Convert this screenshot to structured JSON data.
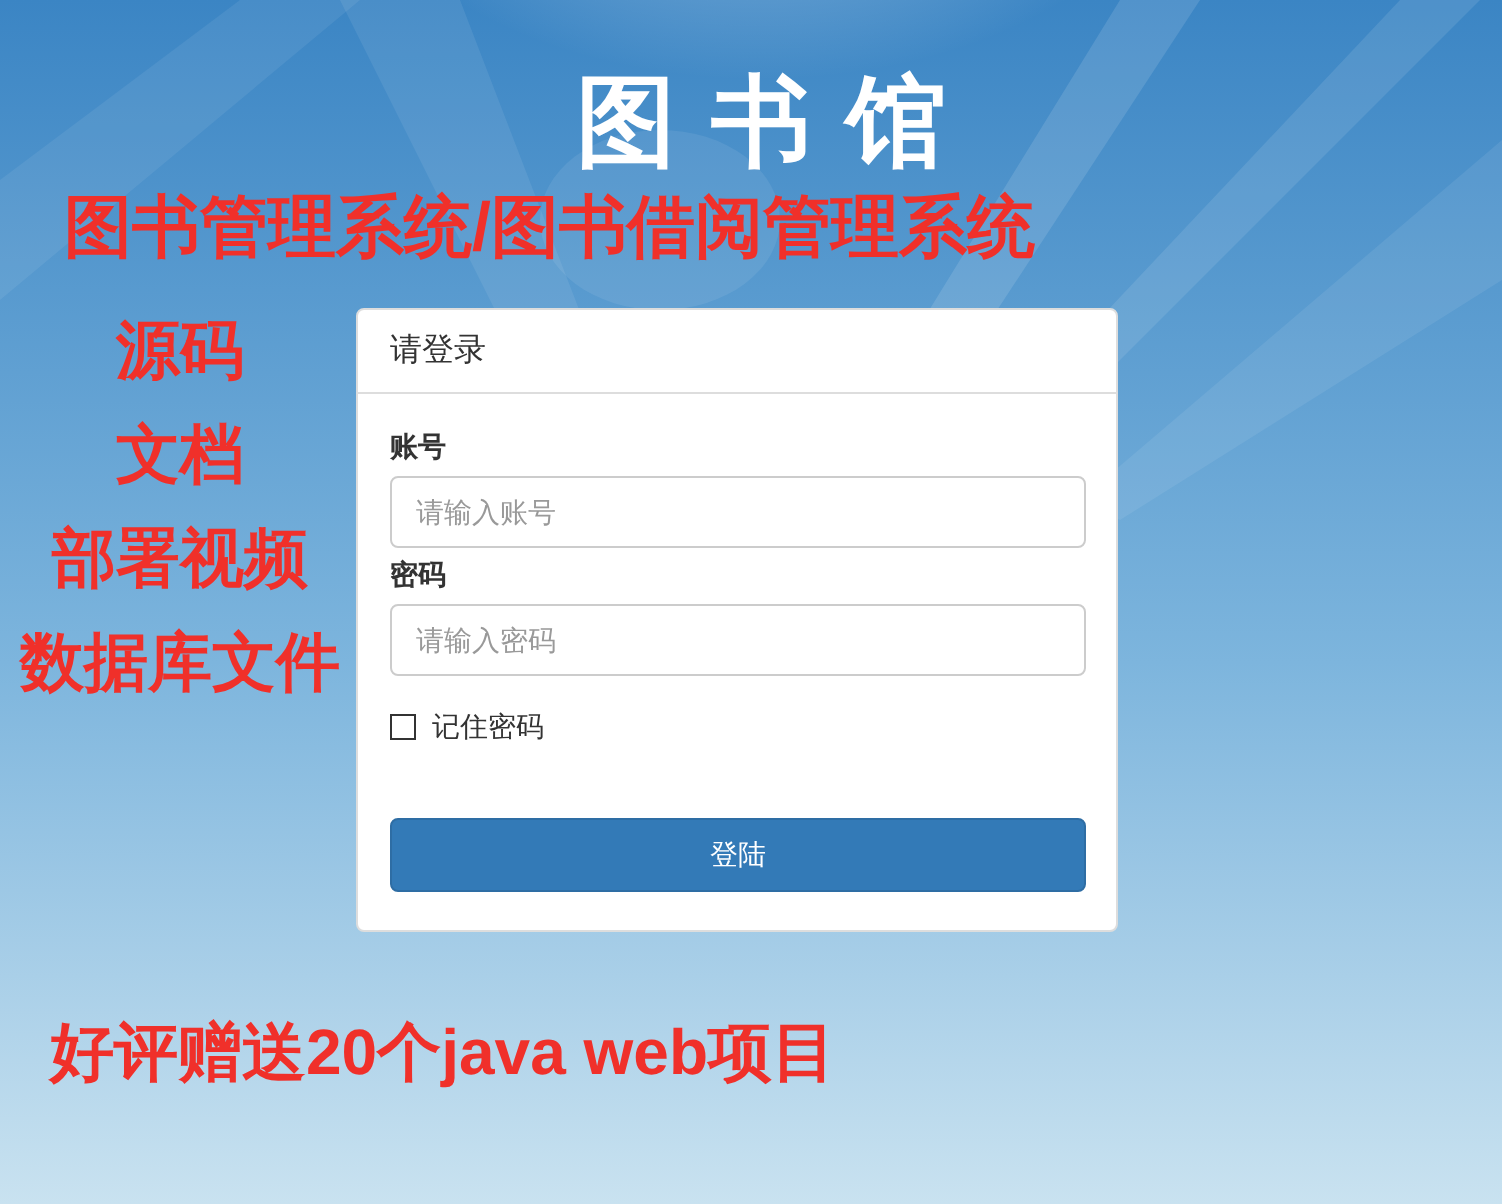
{
  "site_title": "图 书 馆",
  "promo": {
    "headline": "图书管理系统/图书借阅管理系统",
    "features": [
      "源码",
      "文档",
      "部署视频",
      "数据库文件"
    ],
    "footer": "好评赠送20个java web项目"
  },
  "login": {
    "title": "请登录",
    "fields": [
      {
        "label": "账号",
        "placeholder": "请输入账号"
      },
      {
        "label": "密码",
        "placeholder": "请输入密码"
      }
    ],
    "remember": {
      "label": "记住密码",
      "checked": false
    },
    "submit": "登陆"
  }
}
